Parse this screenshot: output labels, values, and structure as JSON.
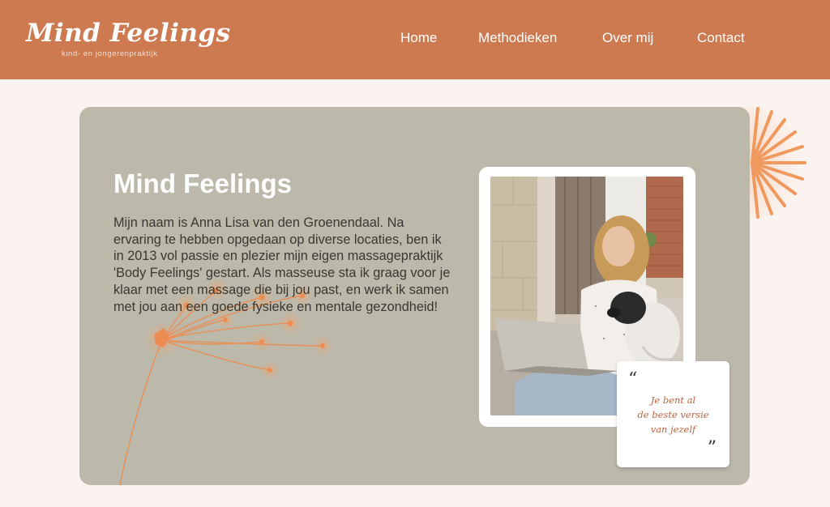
{
  "brand": {
    "name": "Mind Feelings",
    "tagline": "kind- en jongerenpraktijk"
  },
  "nav": {
    "items": [
      "Home",
      "Methodieken",
      "Over mij",
      "Contact"
    ]
  },
  "hero": {
    "title": "Mind Feelings",
    "body": "Mijn naam is Anna Lisa van den Groenendaal. Na ervaring te hebben opgedaan op diverse locaties, ben ik in 2013 vol passie en plezier mijn eigen massagepraktijk 'Body Feelings' gestart. Als masseuse sta ik graag voor je klaar met een massage die bij jou past, en werk ik samen met jou aan een goede fysieke en mentale gezondheid!"
  },
  "quote": {
    "open_mark": "“",
    "close_mark": "”",
    "lines": [
      "Je bent al",
      "de beste versie",
      "van jezelf"
    ]
  },
  "icons": {
    "sun": "sun-burst-icon",
    "dandelion": "dandelion-illustration"
  },
  "colors": {
    "header": "#cd7a50",
    "page_background": "#fbf3ef",
    "card": "#bcb8aa",
    "accent_orange": "#f0995f",
    "quote_text": "#b8643e"
  }
}
